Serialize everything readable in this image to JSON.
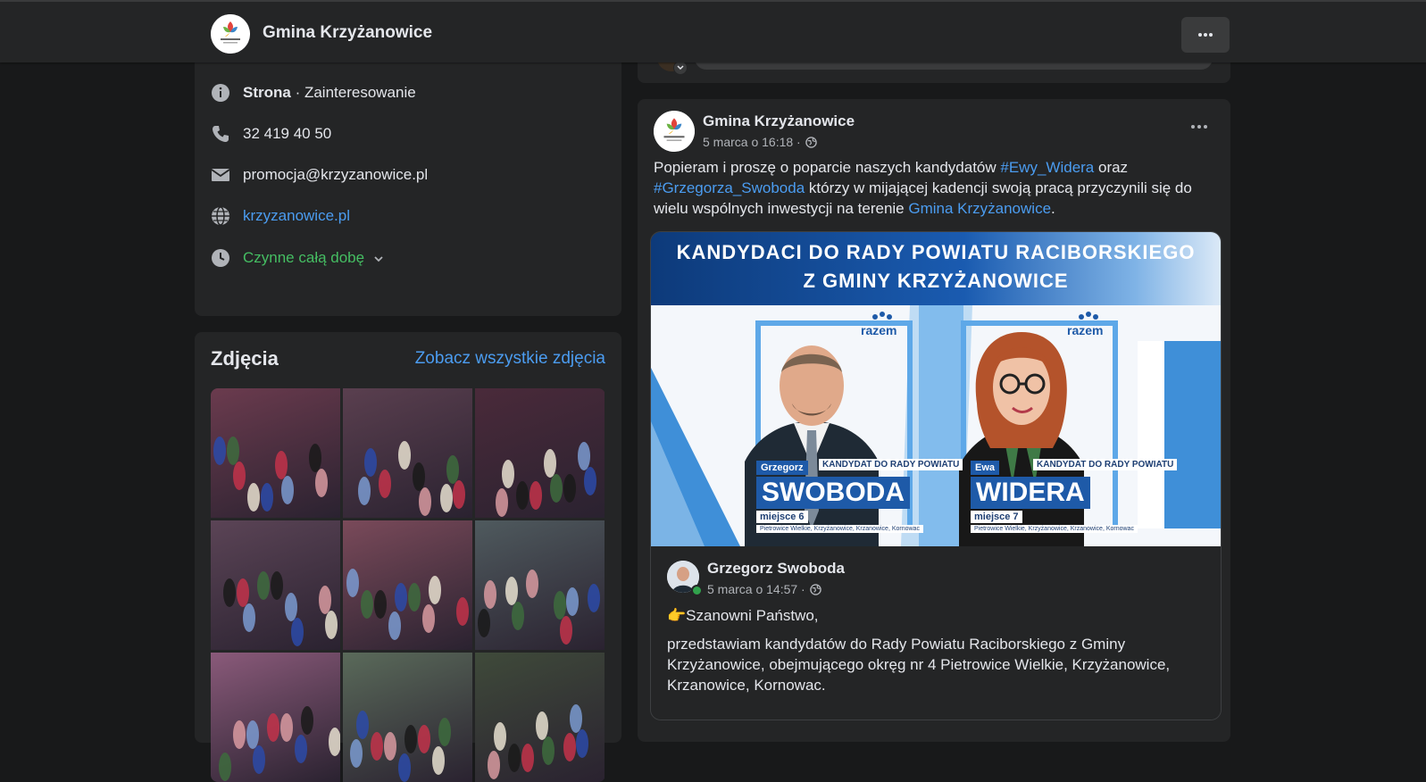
{
  "header": {
    "page_name": "Gmina Krzyżanowice",
    "more_icon": "more-horizontal-icon"
  },
  "about": {
    "category_bold": "Strona",
    "category_rest": " · Zainteresowanie",
    "phone": "32 419 40 50",
    "email": "promocja@krzyzanowice.pl",
    "website": "krzyzanowice.pl",
    "hours": "Czynne całą dobę",
    "icons": [
      "info-icon",
      "phone-icon",
      "mail-icon",
      "globe-icon",
      "clock-icon"
    ]
  },
  "photos": {
    "title": "Zdjęcia",
    "see_all": "Zobacz wszystkie zdjęcia",
    "tiles": [
      "#6b3b4e",
      "#5a3f4f",
      "#4a2a3a",
      "#5b4456",
      "#7a4a5a",
      "#4f5a5e",
      "#8a5a7a",
      "#5a6a5a",
      "#3f4a3a"
    ]
  },
  "post": {
    "author": "Gmina Krzyżanowice",
    "time": "5 marca o 16:18 ·",
    "text_1": "Popieram i proszę o poparcie naszych kandydatów ",
    "hashtag_1": "#Ewy_Widera",
    "text_2": " oraz ",
    "hashtag_2": "#Grzegorza_Swoboda",
    "text_3": " którzy w mijającej kadencji swoją pracą przyczynili się do wielu wspólnych inwestycji na terenie ",
    "mention": "Gmina Krzyżanowice",
    "text_4": "."
  },
  "poster": {
    "banner_line_1": "KANDYDACI DO RADY POWIATU RACIBORSKIEGO",
    "banner_line_2": "Z GMINY KRZYŻANOWICE",
    "logo_text": "razem",
    "candidate_tag": "KANDYDAT DO RADY POWIATU",
    "candidates": [
      {
        "first": "Grzegorz",
        "last": "SWOBODA",
        "place": "miejsce 6",
        "towns": "Pietrowice Wielkie, Krzyżanowice, Krzanowice, Kornowac"
      },
      {
        "first": "Ewa",
        "last": "WIDERA",
        "place": "miejsce 7",
        "towns": "Pietrowice Wielkie, Krzyżanowice, Krzanowice, Kornowac"
      }
    ]
  },
  "shared": {
    "author": "Grzegorz Swoboda",
    "time": "5 marca o 14:57 ·",
    "greeting": "👉Szanowni Państwo,",
    "body": "przedstawiam kandydatów do Rady Powiatu Raciborskiego z Gminy Krzyżanowice, obejmującego okręg nr 4 Pietrowice Wielkie,  Krzyżanowice, Krzanowice, Kornowac."
  }
}
